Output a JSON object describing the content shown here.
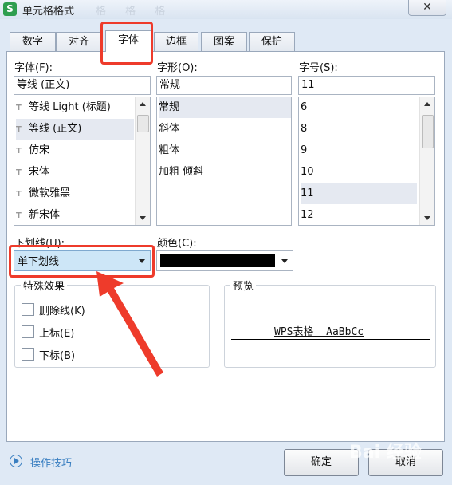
{
  "window": {
    "title": "单元格格式",
    "app_icon": "S",
    "title_ghost": "格 格 格",
    "close_glyph": "✕"
  },
  "tabs": [
    {
      "label": "数字"
    },
    {
      "label": "对齐"
    },
    {
      "label": "字体",
      "active": true
    },
    {
      "label": "边框"
    },
    {
      "label": "图案"
    },
    {
      "label": "保护"
    }
  ],
  "font": {
    "label": "字体(F):",
    "value": "等线 (正文)",
    "items": [
      "等线 Light (标题)",
      "等线 (正文)",
      "仿宋",
      "宋体",
      "微软雅黑",
      "新宋体"
    ],
    "selected_index": 1
  },
  "style": {
    "label": "字形(O):",
    "value": "常规",
    "items": [
      "常规",
      "斜体",
      "粗体",
      "加粗 倾斜"
    ],
    "selected_index": 0
  },
  "size": {
    "label": "字号(S):",
    "value": "11",
    "items": [
      "6",
      "8",
      "9",
      "10",
      "11",
      "12"
    ],
    "selected_index": 4
  },
  "underline": {
    "label": "下划线(U):",
    "value": "单下划线"
  },
  "color": {
    "label": "颜色(C):",
    "swatch": "#000000"
  },
  "effects": {
    "legend": "特殊效果",
    "items": [
      "删除线(K)",
      "上标(E)",
      "下标(B)"
    ]
  },
  "preview": {
    "legend": "预览",
    "sample": "WPS表格  AaBbCc"
  },
  "footer": {
    "tips_label": "操作技巧",
    "ok_label": "确定",
    "cancel_label": "取消"
  },
  "watermark": "Bai 经验",
  "colors": {
    "highlight_red": "#ee3b2b",
    "accent_blue": "#3a7fc1",
    "selected_item_bg": "#e5e9f1",
    "underline_field_bg": "#cde6f7"
  }
}
